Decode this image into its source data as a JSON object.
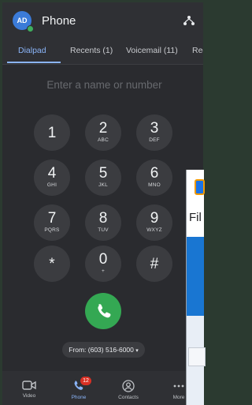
{
  "header": {
    "avatar_initials": "AD",
    "title": "Phone",
    "menu_icon": "connection-icon"
  },
  "tabs": [
    {
      "label": "Dialpad",
      "active": true
    },
    {
      "label": "Recents (1)",
      "active": false
    },
    {
      "label": "Voicemail (11)",
      "active": false
    },
    {
      "label": "Rec",
      "active": false
    }
  ],
  "search": {
    "placeholder": "Enter a name or number"
  },
  "keypad": [
    {
      "digit": "1",
      "letters": ""
    },
    {
      "digit": "2",
      "letters": "ABC"
    },
    {
      "digit": "3",
      "letters": "DEF"
    },
    {
      "digit": "4",
      "letters": "GHI"
    },
    {
      "digit": "5",
      "letters": "JKL"
    },
    {
      "digit": "6",
      "letters": "MNO"
    },
    {
      "digit": "7",
      "letters": "PQRS"
    },
    {
      "digit": "8",
      "letters": "TUV"
    },
    {
      "digit": "9",
      "letters": "WXYZ"
    },
    {
      "digit": "*",
      "letters": ""
    },
    {
      "digit": "0",
      "letters": "+"
    },
    {
      "digit": "#",
      "letters": ""
    }
  ],
  "call_button": {
    "icon": "phone-icon",
    "color": "#34a853"
  },
  "from_number": "From: (603) 516-6000",
  "bottom_nav": [
    {
      "label": "Video",
      "icon": "video-camera-icon",
      "active": false
    },
    {
      "label": "Phone",
      "icon": "phone-icon",
      "active": true,
      "badge": "12"
    },
    {
      "label": "Contacts",
      "icon": "contacts-icon",
      "active": false
    },
    {
      "label": "More",
      "icon": "more-icon",
      "active": false
    }
  ],
  "overlay": {
    "text": "Fil"
  },
  "colors": {
    "accent": "#8ab4f8",
    "call_green": "#34a853",
    "badge_red": "#d93025"
  }
}
